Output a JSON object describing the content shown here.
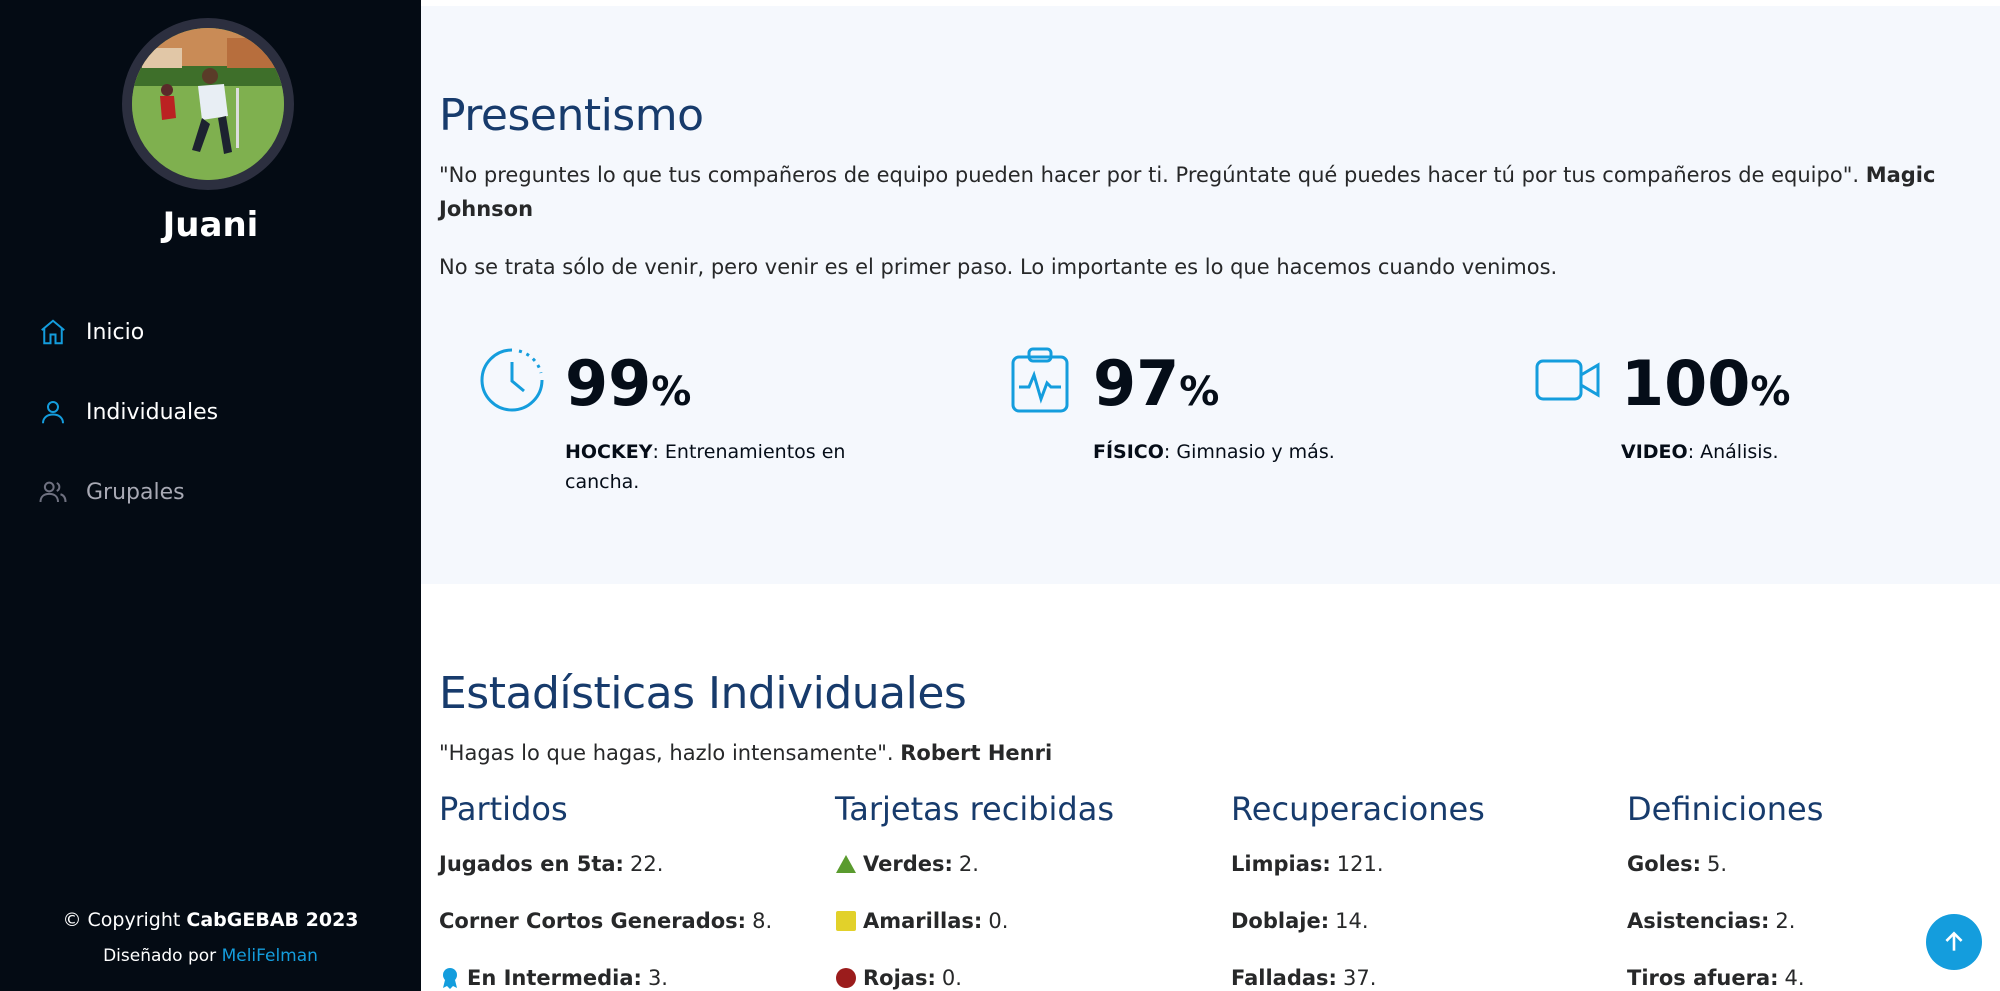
{
  "sidebar": {
    "profile_name": "Juani",
    "nav": [
      {
        "label": "Inicio",
        "icon": "home-icon"
      },
      {
        "label": "Individuales",
        "icon": "person-icon"
      },
      {
        "label": "Grupales",
        "icon": "people-icon"
      }
    ],
    "copyright_prefix": "© Copyright ",
    "copyright_brand": "CabGEBAB 2023",
    "credits_prefix": "Diseñado por ",
    "credits_link": "MeliFelman"
  },
  "presentismo": {
    "title": "Presentismo",
    "quote": "\"No preguntes lo que tus compañeros de equipo pueden hacer por ti. Pregúntate qué puedes hacer tú por tus compañeros de equipo\". ",
    "quote_author": "Magic Johnson",
    "subtitle": "No se trata sólo de venir, pero venir es el primer paso. Lo importante es lo que hacemos cuando venimos.",
    "counters": [
      {
        "icon": "clock-icon",
        "value": "99",
        "unit": "%",
        "label": "HOCKEY",
        "desc": ": Entrenamientos en cancha."
      },
      {
        "icon": "clipboard-pulse-icon",
        "value": "97",
        "unit": "%",
        "label": "FÍSICO",
        "desc": ": Gimnasio y más."
      },
      {
        "icon": "video-camera-icon",
        "value": "100",
        "unit": "%",
        "label": "VIDEO",
        "desc": ": Análisis."
      }
    ]
  },
  "estadisticas": {
    "title": "Estadísticas Individuales",
    "quote": "\"Hagas lo que hagas, hazlo intensamente\". ",
    "quote_author": "Robert Henri",
    "columns": [
      {
        "title": "Partidos",
        "items": [
          {
            "label": "Jugados en 5ta:",
            "value": " 22."
          },
          {
            "label": "Corner Cortos Generados:",
            "value": " 8."
          },
          {
            "label": "En Intermedia:",
            "value": " 3."
          }
        ]
      },
      {
        "title": "Tarjetas recibidas",
        "items": [
          {
            "label": "Verdes:",
            "value": " 2."
          },
          {
            "label": "Amarillas:",
            "value": " 0."
          },
          {
            "label": "Rojas:",
            "value": " 0."
          }
        ]
      },
      {
        "title": "Recuperaciones",
        "items": [
          {
            "label": "Limpias:",
            "value": " 121."
          },
          {
            "label": "Doblaje:",
            "value": " 14."
          },
          {
            "label": "Falladas:",
            "value": " 37."
          }
        ]
      },
      {
        "title": "Definiciones",
        "items": [
          {
            "label": "Goles:",
            "value": " 5."
          },
          {
            "label": "Asistencias:",
            "value": " 2."
          },
          {
            "label": "Tiros afuera:",
            "value": " 4."
          }
        ]
      }
    ]
  },
  "colors": {
    "accent": "#149ddd",
    "sidebar_bg": "#040b14",
    "green_card": "#5a9b2e",
    "yellow_card": "#e2d12a",
    "red_card": "#9b1c1c"
  }
}
